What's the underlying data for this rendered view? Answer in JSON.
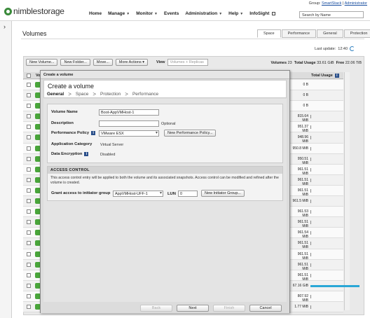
{
  "header": {
    "brand": "nimblestorage",
    "group_prefix": "Group:",
    "group_name": "SmartStack",
    "separator": "|",
    "user": "Administrator",
    "search_placeholder": "Search by Name",
    "nav": [
      {
        "label": "Home",
        "has_caret": false
      },
      {
        "label": "Manage",
        "has_caret": true
      },
      {
        "label": "Monitor",
        "has_caret": true
      },
      {
        "label": "Events",
        "has_caret": false
      },
      {
        "label": "Administration",
        "has_caret": true
      },
      {
        "label": "Help",
        "has_caret": true
      },
      {
        "label": "InfoSight",
        "has_caret": false,
        "external": true
      }
    ]
  },
  "page": {
    "title": "Volumes",
    "tabs": [
      "Space",
      "Performance",
      "General",
      "Protection"
    ],
    "active_tab": "Space",
    "last_update_label": "Last update:",
    "last_update_time": "12:40"
  },
  "toolbar": {
    "new_volume": "New Volume...",
    "new_folder": "New Folder...",
    "move": "Move...",
    "more_actions": "More Actions",
    "view_label": "View",
    "view_value": "Volumes + Replicas"
  },
  "stats": {
    "volumes_label": "Volumes",
    "volumes_count": "23",
    "total_usage_label": "Total Usage",
    "total_usage": "33.61 GiB",
    "free_label": "Free",
    "free": "22.06 TiB"
  },
  "table": {
    "col_volume": "Vo",
    "col_total_usage": "Total Usage",
    "rows": [
      {
        "usage": "0 B",
        "bar_fraction": 0
      },
      {
        "usage": "0 B",
        "bar_fraction": 0
      },
      {
        "usage": "0 B",
        "bar_fraction": 0
      },
      {
        "usage": "815.64 MiB",
        "bar_fraction": 0
      },
      {
        "usage": "951.37 MiB",
        "bar_fraction": 0
      },
      {
        "usage": "948.96 MiB",
        "bar_fraction": 0
      },
      {
        "usage": "950.8 MiB",
        "bar_fraction": 0
      },
      {
        "usage": "950.51 MiB",
        "bar_fraction": 0
      },
      {
        "usage": "961.51 MiB",
        "bar_fraction": 0
      },
      {
        "usage": "961.51 MiB",
        "bar_fraction": 0
      },
      {
        "usage": "961.51 MiB",
        "bar_fraction": 0
      },
      {
        "usage": "961.5 MiB",
        "bar_fraction": 0
      },
      {
        "usage": "961.53 MiB",
        "bar_fraction": 0
      },
      {
        "usage": "961.51 MiB",
        "bar_fraction": 0
      },
      {
        "usage": "961.54 MiB",
        "bar_fraction": 0
      },
      {
        "usage": "961.51 MiB",
        "bar_fraction": 0
      },
      {
        "usage": "961.51 MiB",
        "bar_fraction": 0
      },
      {
        "usage": "961.51 MiB",
        "bar_fraction": 0
      },
      {
        "usage": "961.51 MiB",
        "bar_fraction": 0
      },
      {
        "usage": "67.16 GiB",
        "bar_fraction": 1.0
      },
      {
        "usage": "807.92 MiB",
        "bar_fraction": 0
      },
      {
        "usage": "1.77 MiB",
        "bar_fraction": 0
      }
    ]
  },
  "dialog": {
    "window_title": "Create a volume",
    "heading": "Create a volume",
    "steps": [
      "General",
      "Space",
      "Protection",
      "Performance"
    ],
    "active_step": "General",
    "step_separator": ">",
    "volume_name_label": "Volume Name",
    "volume_name_value": "Boot-AppVMHost-1",
    "description_label": "Description",
    "description_value": "",
    "description_hint": "Optional",
    "performance_policy_label": "Performance Policy",
    "performance_policy_value": "VMware ESX",
    "new_performance_policy": "New Performance Policy...",
    "application_category_label": "Application Category",
    "application_category_value": "Virtual Server",
    "data_encryption_label": "Data Encryption",
    "data_encryption_value": "Disabled",
    "access_control_title": "ACCESS CONTROL",
    "access_control_text": "This access control entry will be applied to both the volume and its associated snapshots. Access control can be modified and refined after the volume is created.",
    "initiator_group_label": "Grant access to initiator group",
    "initiator_group_value": "AppVMHost-UFF-1",
    "lun_label": "LUN",
    "lun_value": "0",
    "new_initiator_group": "New Initiator Group...",
    "buttons": {
      "back": "Back",
      "next": "Next",
      "finish": "Finish",
      "cancel": "Cancel"
    }
  },
  "colors": {
    "status_ok": "#49a53a",
    "usage_bar": "#2aa7d6",
    "info_icon": "#2a4f8a"
  }
}
